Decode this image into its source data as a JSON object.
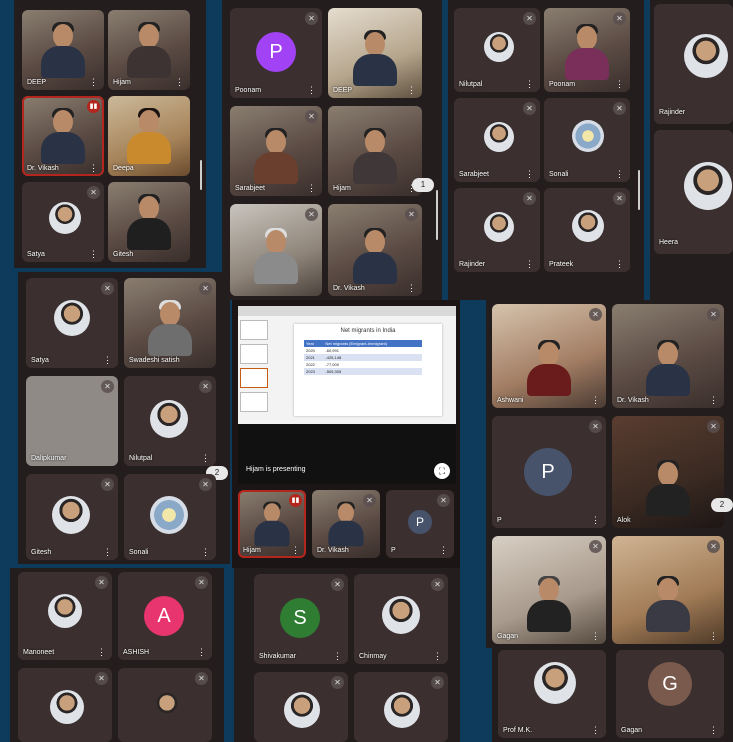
{
  "colors": {
    "speaking": "#b3261e",
    "background": "#0e3a5c"
  },
  "panelA": {
    "tiles": [
      {
        "name": "DEEP",
        "video": true
      },
      {
        "name": "Hijam",
        "video": true
      },
      {
        "name": "Dr. Vikash",
        "video": true,
        "speaking": true
      },
      {
        "name": "Deepa",
        "video": true
      },
      {
        "name": "Satya",
        "muted": true
      },
      {
        "name": "Gitesh",
        "video": true
      }
    ]
  },
  "panelB": {
    "tiles": [
      {
        "name": "Poonam",
        "avatar": "P",
        "avatar_color": "#a142f4",
        "muted": true
      },
      {
        "name": "DEEP",
        "video": true
      },
      {
        "name": "Sarabjeet",
        "video": true,
        "muted": true
      },
      {
        "name": "Hijam",
        "video": true
      },
      {
        "name": "",
        "video": true,
        "muted": true
      },
      {
        "name": "Dr. Vikash",
        "video": true,
        "muted": true
      }
    ],
    "page_badge": "1"
  },
  "panelC": {
    "tiles": [
      {
        "name": "Nilutpal",
        "muted": true
      },
      {
        "name": "Poonam",
        "video": true,
        "muted": true
      },
      {
        "name": "Sarabjeet",
        "muted": true
      },
      {
        "name": "Sonali",
        "muted": true
      },
      {
        "name": "Rajinder",
        "muted": true
      },
      {
        "name": "Prateek",
        "muted": true
      }
    ]
  },
  "panelD": {
    "tiles": [
      {
        "name": "Rajinder"
      },
      {
        "name": "Heera"
      }
    ]
  },
  "panelE": {
    "tiles": [
      {
        "name": "Satya",
        "muted": true
      },
      {
        "name": "Swadeshi satish",
        "video": true,
        "muted": true
      },
      {
        "name": "Dalipkumar",
        "muted": true
      },
      {
        "name": "Nilutpal",
        "muted": true
      },
      {
        "name": "Gitesh",
        "muted": true
      },
      {
        "name": "Sonali",
        "muted": true
      }
    ],
    "page_badge": "2"
  },
  "presentation": {
    "slide_title": "Net migrants in India",
    "table_headers": [
      "Year",
      "Net migrants (Emigrant-Immigrant)"
    ],
    "table_rows": [
      [
        "2020",
        "-60,991"
      ],
      [
        "2021",
        "-425,148"
      ],
      [
        "2022",
        "-77,000"
      ],
      [
        "2023",
        "-509,305"
      ]
    ],
    "presenting_label": "Hijam is presenting",
    "fullscreen_icon": "fullscreen-icon",
    "strip": [
      {
        "name": "Hijam",
        "video": true,
        "speaking": true
      },
      {
        "name": "Dr. Vikash",
        "video": true,
        "muted": true
      },
      {
        "name": "P",
        "avatar": "P",
        "avatar_color": "#47536b",
        "muted": true
      }
    ]
  },
  "panelF": {
    "tiles": [
      {
        "name": "Ashwani",
        "video": true,
        "muted": true
      },
      {
        "name": "Dr. Vikash",
        "video": true,
        "muted": true
      },
      {
        "name": "P",
        "avatar": "P",
        "avatar_color": "#47536b",
        "muted": true
      },
      {
        "name": "Alok",
        "video": true,
        "muted": true
      },
      {
        "name": "Gagan",
        "video": true,
        "muted": true
      },
      {
        "name": "",
        "video": true,
        "muted": true
      }
    ],
    "page_badge": "2"
  },
  "panelG": {
    "tiles": [
      {
        "name": "Manoneet",
        "muted": true
      },
      {
        "name": "ASHISH",
        "avatar": "A",
        "avatar_color": "#e8346f",
        "muted": true
      },
      {
        "name": "",
        "muted": true
      },
      {
        "name": "",
        "muted": true
      }
    ]
  },
  "panelH": {
    "tiles": [
      {
        "name": "Shivakumar",
        "avatar": "S",
        "avatar_color": "#2e7d32",
        "muted": true
      },
      {
        "name": "Chinmay",
        "muted": true
      },
      {
        "name": "",
        "muted": true
      },
      {
        "name": "",
        "muted": true
      }
    ]
  },
  "panelI": {
    "tiles": [
      {
        "name": "Prof M.K."
      },
      {
        "name": "Gagan",
        "avatar": "G",
        "avatar_color": "#7a5a4c"
      }
    ]
  }
}
